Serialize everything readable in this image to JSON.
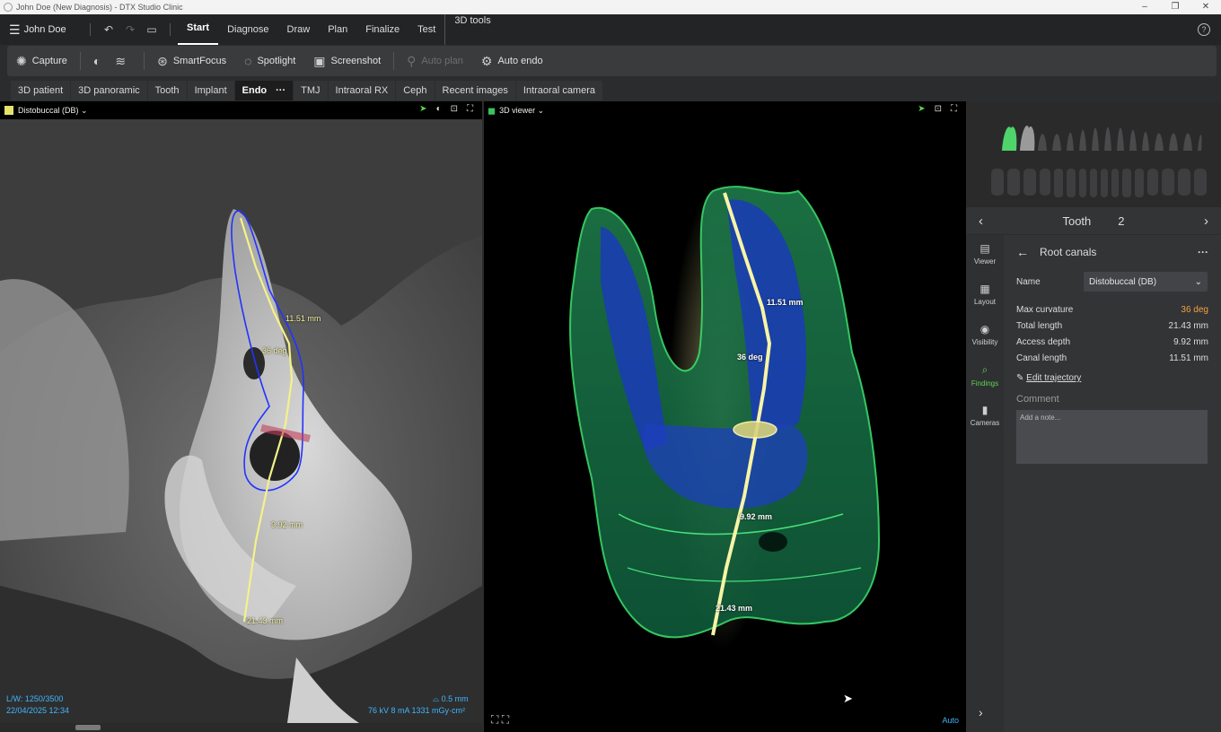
{
  "window": {
    "title": "John Doe (New Diagnosis) - DTX Studio Clinic",
    "controls": [
      "–",
      "❐",
      "✕"
    ]
  },
  "menubar": {
    "user": "John Doe",
    "items": [
      {
        "label": "Start",
        "active": true
      },
      {
        "label": "Diagnose",
        "active": false
      },
      {
        "label": "Draw",
        "active": false
      },
      {
        "label": "Plan",
        "active": false
      },
      {
        "label": "Finalize",
        "active": false
      },
      {
        "label": "Test",
        "active": false
      },
      {
        "label": "3D tools",
        "active": false
      }
    ],
    "help": "?"
  },
  "toolbar": {
    "capture": "Capture",
    "smartfocus": "SmartFocus",
    "spotlight": "Spotlight",
    "screenshot": "Screenshot",
    "autoplan": "Auto plan",
    "autoendo": "Auto endo"
  },
  "tabs": [
    {
      "label": "3D patient"
    },
    {
      "label": "3D panoramic"
    },
    {
      "label": "Tooth"
    },
    {
      "label": "Implant"
    },
    {
      "label": "Endo",
      "active": true
    },
    {
      "label": "TMJ"
    },
    {
      "label": "Intraoral RX"
    },
    {
      "label": "Ceph"
    },
    {
      "label": "Recent images"
    },
    {
      "label": "Intraoral camera"
    }
  ],
  "left_view": {
    "title": "Distobuccal (DB)",
    "swatch_color": "#e5e36a",
    "measurements": {
      "canal": "11.51 mm",
      "angle": "36 deg",
      "access": "9.92 mm",
      "total": "21.43 mm"
    },
    "lw": "L/W: 1250/3500",
    "date": "22/04/2025 12:34",
    "slice": "0.5 mm",
    "exposure": "76 kV  8 mA  1331 mGy·cm²"
  },
  "right_view": {
    "title": "3D viewer",
    "measurements": {
      "canal": "11.51 mm",
      "angle": "36 deg",
      "access": "9.92 mm",
      "total": "21.43 mm"
    },
    "mode": "Auto"
  },
  "tooth_nav": {
    "label": "Tooth",
    "number": "2"
  },
  "side_strip": [
    {
      "label": "Viewer",
      "icon": "viewer-icon"
    },
    {
      "label": "Layout",
      "icon": "layout-icon"
    },
    {
      "label": "Visibility",
      "icon": "eye-icon"
    },
    {
      "label": "Findings",
      "icon": "findings-icon",
      "active": true
    },
    {
      "label": "Cameras",
      "icon": "camera-icon"
    }
  ],
  "root_canals": {
    "title": "Root canals",
    "name_label": "Name",
    "name_value": "Distobuccal (DB)",
    "stats": [
      {
        "label": "Max curvature",
        "value": "36 deg",
        "warn": true
      },
      {
        "label": "Total length",
        "value": "21.43 mm"
      },
      {
        "label": "Access depth",
        "value": "9.92 mm"
      },
      {
        "label": "Canal length",
        "value": "11.51 mm"
      }
    ],
    "edit": "Edit trajectory",
    "comment_title": "Comment",
    "comment_placeholder": "Add a note..."
  }
}
